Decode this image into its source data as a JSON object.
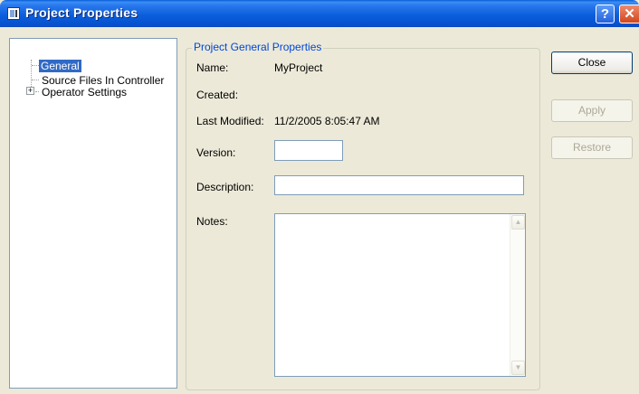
{
  "window": {
    "title": "Project Properties",
    "help_glyph": "?",
    "close_glyph": "✕"
  },
  "tree": {
    "items": [
      {
        "label": "General",
        "selected": true
      },
      {
        "label": "Source Files In Controller",
        "selected": false
      },
      {
        "label": "Operator Settings",
        "selected": false
      }
    ],
    "expander_glyph": "+"
  },
  "group": {
    "title": "Project General Properties",
    "name_label": "Name:",
    "name_value": "MyProject",
    "created_label": "Created:",
    "created_value": "",
    "last_modified_label": "Last Modified:",
    "last_modified_value": "11/2/2005 8:05:47 AM",
    "version_label": "Version:",
    "version_value": "",
    "description_label": "Description:",
    "description_value": "",
    "notes_label": "Notes:",
    "notes_value": "",
    "scroll_up_glyph": "▲",
    "scroll_down_glyph": "▼"
  },
  "buttons": {
    "close": "Close",
    "apply": "Apply",
    "restore": "Restore"
  },
  "colors": {
    "titlebar": "#0753d2",
    "selection": "#316ac5",
    "group_title": "#0046d5"
  }
}
